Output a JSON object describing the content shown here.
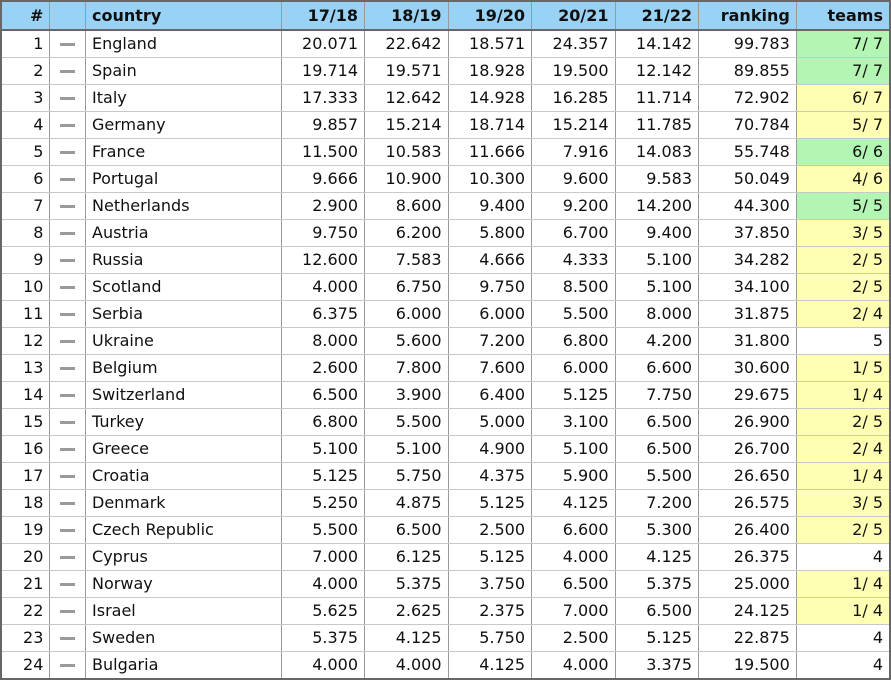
{
  "table": {
    "columns": [
      {
        "key": "rank",
        "label": "#",
        "align": "right"
      },
      {
        "key": "trend",
        "label": "",
        "align": "center"
      },
      {
        "key": "country",
        "label": "country",
        "align": "left"
      },
      {
        "key": "s1718",
        "label": "17/18",
        "align": "right"
      },
      {
        "key": "s1819",
        "label": "18/19",
        "align": "right"
      },
      {
        "key": "s1920",
        "label": "19/20",
        "align": "right"
      },
      {
        "key": "s2021",
        "label": "20/21",
        "align": "right"
      },
      {
        "key": "s2122",
        "label": "21/22",
        "align": "right"
      },
      {
        "key": "ranking",
        "label": "ranking",
        "align": "right"
      },
      {
        "key": "teams",
        "label": "teams",
        "align": "right"
      }
    ],
    "trend_icon": "horizontal-dash-icon",
    "group_size": 4,
    "colors": {
      "header_bg": "#9ad2f5",
      "teams_full_bg": "#b3f5b3",
      "teams_partial_bg": "#ffffb3",
      "teams_plain_bg": "#ffffff",
      "border": "#676767",
      "text": "#101010"
    },
    "rows": [
      {
        "rank": "1",
        "trend": "—",
        "country": "England",
        "s1718": "20.071",
        "s1819": "22.642",
        "s1920": "18.571",
        "s2021": "24.357",
        "s2122": "14.142",
        "ranking": "99.783",
        "teams": "7/ 7",
        "teams_state": "full"
      },
      {
        "rank": "2",
        "trend": "—",
        "country": "Spain",
        "s1718": "19.714",
        "s1819": "19.571",
        "s1920": "18.928",
        "s2021": "19.500",
        "s2122": "12.142",
        "ranking": "89.855",
        "teams": "7/ 7",
        "teams_state": "full"
      },
      {
        "rank": "3",
        "trend": "—",
        "country": "Italy",
        "s1718": "17.333",
        "s1819": "12.642",
        "s1920": "14.928",
        "s2021": "16.285",
        "s2122": "11.714",
        "ranking": "72.902",
        "teams": "6/ 7",
        "teams_state": "part"
      },
      {
        "rank": "4",
        "trend": "—",
        "country": "Germany",
        "s1718": "9.857",
        "s1819": "15.214",
        "s1920": "18.714",
        "s2021": "15.214",
        "s2122": "11.785",
        "ranking": "70.784",
        "teams": "5/ 7",
        "teams_state": "part"
      },
      {
        "rank": "5",
        "trend": "—",
        "country": "France",
        "s1718": "11.500",
        "s1819": "10.583",
        "s1920": "11.666",
        "s2021": "7.916",
        "s2122": "14.083",
        "ranking": "55.748",
        "teams": "6/ 6",
        "teams_state": "full"
      },
      {
        "rank": "6",
        "trend": "—",
        "country": "Portugal",
        "s1718": "9.666",
        "s1819": "10.900",
        "s1920": "10.300",
        "s2021": "9.600",
        "s2122": "9.583",
        "ranking": "50.049",
        "teams": "4/ 6",
        "teams_state": "part"
      },
      {
        "rank": "7",
        "trend": "—",
        "country": "Netherlands",
        "s1718": "2.900",
        "s1819": "8.600",
        "s1920": "9.400",
        "s2021": "9.200",
        "s2122": "14.200",
        "ranking": "44.300",
        "teams": "5/ 5",
        "teams_state": "full"
      },
      {
        "rank": "8",
        "trend": "—",
        "country": "Austria",
        "s1718": "9.750",
        "s1819": "6.200",
        "s1920": "5.800",
        "s2021": "6.700",
        "s2122": "9.400",
        "ranking": "37.850",
        "teams": "3/ 5",
        "teams_state": "part"
      },
      {
        "rank": "9",
        "trend": "—",
        "country": "Russia",
        "s1718": "12.600",
        "s1819": "7.583",
        "s1920": "4.666",
        "s2021": "4.333",
        "s2122": "5.100",
        "ranking": "34.282",
        "teams": "2/ 5",
        "teams_state": "part"
      },
      {
        "rank": "10",
        "trend": "—",
        "country": "Scotland",
        "s1718": "4.000",
        "s1819": "6.750",
        "s1920": "9.750",
        "s2021": "8.500",
        "s2122": "5.100",
        "ranking": "34.100",
        "teams": "2/ 5",
        "teams_state": "part"
      },
      {
        "rank": "11",
        "trend": "—",
        "country": "Serbia",
        "s1718": "6.375",
        "s1819": "6.000",
        "s1920": "6.000",
        "s2021": "5.500",
        "s2122": "8.000",
        "ranking": "31.875",
        "teams": "2/ 4",
        "teams_state": "part"
      },
      {
        "rank": "12",
        "trend": "—",
        "country": "Ukraine",
        "s1718": "8.000",
        "s1819": "5.600",
        "s1920": "7.200",
        "s2021": "6.800",
        "s2122": "4.200",
        "ranking": "31.800",
        "teams": "5",
        "teams_state": "plain"
      },
      {
        "rank": "13",
        "trend": "—",
        "country": "Belgium",
        "s1718": "2.600",
        "s1819": "7.800",
        "s1920": "7.600",
        "s2021": "6.000",
        "s2122": "6.600",
        "ranking": "30.600",
        "teams": "1/ 5",
        "teams_state": "part"
      },
      {
        "rank": "14",
        "trend": "—",
        "country": "Switzerland",
        "s1718": "6.500",
        "s1819": "3.900",
        "s1920": "6.400",
        "s2021": "5.125",
        "s2122": "7.750",
        "ranking": "29.675",
        "teams": "1/ 4",
        "teams_state": "part"
      },
      {
        "rank": "15",
        "trend": "—",
        "country": "Turkey",
        "s1718": "6.800",
        "s1819": "5.500",
        "s1920": "5.000",
        "s2021": "3.100",
        "s2122": "6.500",
        "ranking": "26.900",
        "teams": "2/ 5",
        "teams_state": "part"
      },
      {
        "rank": "16",
        "trend": "—",
        "country": "Greece",
        "s1718": "5.100",
        "s1819": "5.100",
        "s1920": "4.900",
        "s2021": "5.100",
        "s2122": "6.500",
        "ranking": "26.700",
        "teams": "2/ 4",
        "teams_state": "part"
      },
      {
        "rank": "17",
        "trend": "—",
        "country": "Croatia",
        "s1718": "5.125",
        "s1819": "5.750",
        "s1920": "4.375",
        "s2021": "5.900",
        "s2122": "5.500",
        "ranking": "26.650",
        "teams": "1/ 4",
        "teams_state": "part"
      },
      {
        "rank": "18",
        "trend": "—",
        "country": "Denmark",
        "s1718": "5.250",
        "s1819": "4.875",
        "s1920": "5.125",
        "s2021": "4.125",
        "s2122": "7.200",
        "ranking": "26.575",
        "teams": "3/ 5",
        "teams_state": "part"
      },
      {
        "rank": "19",
        "trend": "—",
        "country": "Czech Republic",
        "s1718": "5.500",
        "s1819": "6.500",
        "s1920": "2.500",
        "s2021": "6.600",
        "s2122": "5.300",
        "ranking": "26.400",
        "teams": "2/ 5",
        "teams_state": "part"
      },
      {
        "rank": "20",
        "trend": "—",
        "country": "Cyprus",
        "s1718": "7.000",
        "s1819": "6.125",
        "s1920": "5.125",
        "s2021": "4.000",
        "s2122": "4.125",
        "ranking": "26.375",
        "teams": "4",
        "teams_state": "plain"
      },
      {
        "rank": "21",
        "trend": "—",
        "country": "Norway",
        "s1718": "4.000",
        "s1819": "5.375",
        "s1920": "3.750",
        "s2021": "6.500",
        "s2122": "5.375",
        "ranking": "25.000",
        "teams": "1/ 4",
        "teams_state": "part"
      },
      {
        "rank": "22",
        "trend": "—",
        "country": "Israel",
        "s1718": "5.625",
        "s1819": "2.625",
        "s1920": "2.375",
        "s2021": "7.000",
        "s2122": "6.500",
        "ranking": "24.125",
        "teams": "1/ 4",
        "teams_state": "part"
      },
      {
        "rank": "23",
        "trend": "—",
        "country": "Sweden",
        "s1718": "5.375",
        "s1819": "4.125",
        "s1920": "5.750",
        "s2021": "2.500",
        "s2122": "5.125",
        "ranking": "22.875",
        "teams": "4",
        "teams_state": "plain"
      },
      {
        "rank": "24",
        "trend": "—",
        "country": "Bulgaria",
        "s1718": "4.000",
        "s1819": "4.000",
        "s1920": "4.125",
        "s2021": "4.000",
        "s2122": "3.375",
        "ranking": "19.500",
        "teams": "4",
        "teams_state": "plain"
      }
    ]
  }
}
